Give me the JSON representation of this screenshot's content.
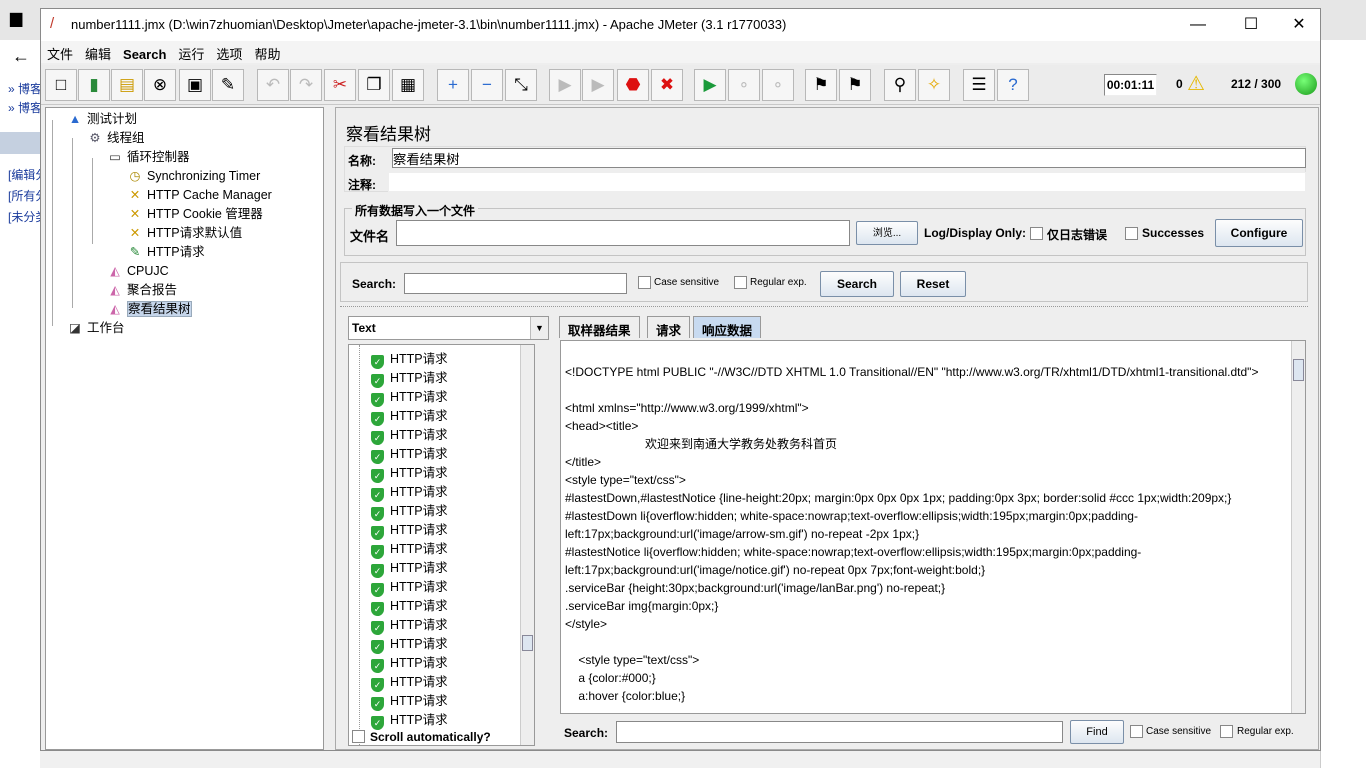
{
  "background": {
    "links": [
      "» 博客",
      "» 博客",
      "[编辑分",
      "[所有分",
      "[未分类"
    ]
  },
  "window": {
    "title": "number1111.jmx (D:\\win7zhuomian\\Desktop\\Jmeter\\apache-jmeter-3.1\\bin\\number1111.jmx) - Apache JMeter (3.1 r1770033)",
    "minimize": "—",
    "maximize": "☐",
    "close": "✕"
  },
  "menu": [
    "文件",
    "编辑",
    "Search",
    "运行",
    "选项",
    "帮助"
  ],
  "toolbar": {
    "icons": [
      "new-icon",
      "templates-icon",
      "open-icon",
      "close-icon",
      "save-icon",
      "save-as-icon",
      "undo-icon",
      "redo-icon",
      "cut-icon",
      "copy-icon",
      "paste-icon",
      "expand-icon",
      "collapse-icon",
      "toggle-icon",
      "start-icon",
      "start-no-pause-icon",
      "stop-icon",
      "shutdown-icon",
      "remote-start-icon",
      "remote-stop-icon",
      "remote-shutdown-icon",
      "clear-icon",
      "clear-all-icon",
      "search-icon",
      "reset-search-icon",
      "function-helper-icon",
      "help-icon"
    ],
    "timer": "00:01:11",
    "warnings": "0",
    "threads": "212 / 300"
  },
  "tree": [
    {
      "label": "测试计划",
      "icon": "test-plan-icon"
    },
    {
      "label": "线程组",
      "icon": "thread-group-icon"
    },
    {
      "label": "循环控制器",
      "icon": "loop-controller-icon"
    },
    {
      "label": "Synchronizing Timer",
      "icon": "timer-icon"
    },
    {
      "label": "HTTP Cache Manager",
      "icon": "config-tool-icon"
    },
    {
      "label": "HTTP Cookie 管理器",
      "icon": "config-tool-icon"
    },
    {
      "label": "HTTP请求默认值",
      "icon": "config-tool-icon"
    },
    {
      "label": "HTTP请求",
      "icon": "sampler-icon"
    },
    {
      "label": "CPUJC",
      "icon": "listener-icon"
    },
    {
      "label": "聚合报告",
      "icon": "listener-icon"
    },
    {
      "label": "察看结果树",
      "icon": "listener-icon"
    },
    {
      "label": "工作台",
      "icon": "workbench-icon"
    }
  ],
  "panel": {
    "title": "察看结果树",
    "name_label": "名称:",
    "name_value": "察看结果树",
    "comment_label": "注释:",
    "file_group": "所有数据写入一个文件",
    "file_label": "文件名",
    "browse": "浏览...",
    "log_display": "Log/Display Only:",
    "errors_only": "仅日志错误",
    "successes": "Successes",
    "configure": "Configure",
    "search_label": "Search:",
    "case_sensitive": "Case sensitive",
    "regular_exp": "Regular exp.",
    "search_btn": "Search",
    "reset_btn": "Reset",
    "renderer": "Text",
    "scroll_auto": "Scroll automatically?",
    "results": [
      "HTTP请求",
      "HTTP请求",
      "HTTP请求",
      "HTTP请求",
      "HTTP请求",
      "HTTP请求",
      "HTTP请求",
      "HTTP请求",
      "HTTP请求",
      "HTTP请求",
      "HTTP请求",
      "HTTP请求",
      "HTTP请求",
      "HTTP请求",
      "HTTP请求",
      "HTTP请求",
      "HTTP请求",
      "HTTP请求",
      "HTTP请求",
      "HTTP请求"
    ],
    "tabs": [
      "取样器结果",
      "请求",
      "响应数据"
    ],
    "response": "\n<!DOCTYPE html PUBLIC \"-//W3C//DTD XHTML 1.0 Transitional//EN\" \"http://www.w3.org/TR/xhtml1/DTD/xhtml1-transitional.dtd\">\n\n<html xmlns=\"http://www.w3.org/1999/xhtml\">\n<head><title>\n                        欢迎来到南通大学教务处教务科首页\n</title>\n<style type=\"text/css\">\n#lastestDown,#lastestNotice {line-height:20px; margin:0px 0px 0px 1px; padding:0px 3px; border:solid #ccc 1px;width:209px;}\n#lastestDown li{overflow:hidden; white-space:nowrap;text-overflow:ellipsis;width:195px;margin:0px;padding-left:17px;background:url('image/arrow-sm.gif') no-repeat -2px 1px;}\n#lastestNotice li{overflow:hidden; white-space:nowrap;text-overflow:ellipsis;width:195px;margin:0px;padding-left:17px;background:url('image/notice.gif') no-repeat 0px 7px;font-weight:bold;}\n.serviceBar {height:30px;background:url('image/lanBar.png') no-repeat;}\n.serviceBar img{margin:0px;}\n</style>\n\n    <style type=\"text/css\">\n    a {color:#000;}\n    a:hover {color:blue;}",
    "find_label": "Search:",
    "find_btn": "Find",
    "find_case": "Case sensitive",
    "find_regex": "Regular exp."
  },
  "colors": {
    "accent": "#c8daf0",
    "success": "#2da63a",
    "running": "#22aa22"
  }
}
